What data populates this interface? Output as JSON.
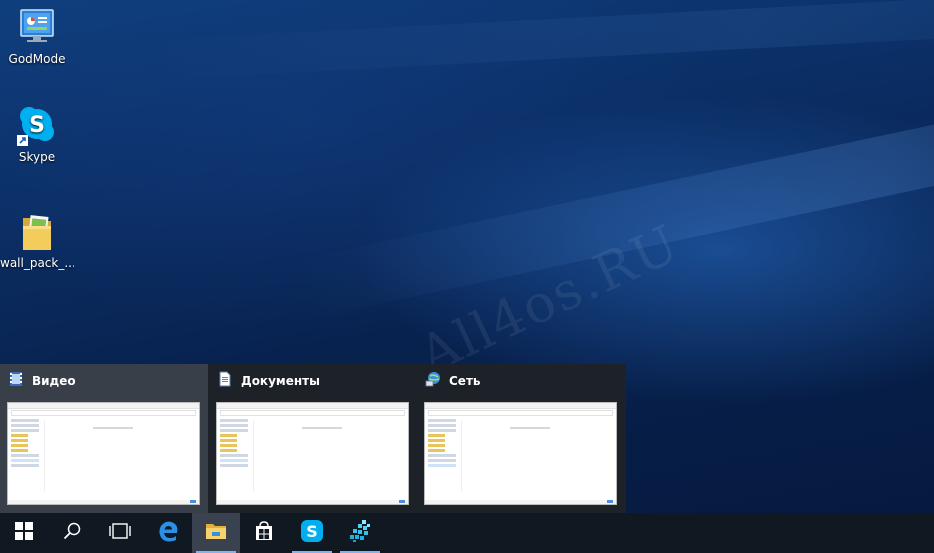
{
  "desktop": {
    "watermark": "All4os.RU",
    "icons": [
      {
        "label": "GodMode",
        "icon": "control-panel-icon"
      },
      {
        "label": "Skype",
        "icon": "skype-icon"
      },
      {
        "label": "wall_pack_...",
        "icon": "folder-icon"
      }
    ]
  },
  "flyout": {
    "windows": [
      {
        "title": "Видео",
        "icon": "videos-folder-icon"
      },
      {
        "title": "Документы",
        "icon": "documents-folder-icon"
      },
      {
        "title": "Сеть",
        "icon": "network-icon"
      }
    ]
  },
  "taskbar": {
    "buttons": [
      {
        "name": "start",
        "icon": "windows-logo-icon"
      },
      {
        "name": "search",
        "icon": "search-icon"
      },
      {
        "name": "task-view",
        "icon": "task-view-icon"
      },
      {
        "name": "edge",
        "icon": "edge-icon"
      },
      {
        "name": "file-explorer",
        "icon": "file-explorer-icon",
        "state": "active"
      },
      {
        "name": "store",
        "icon": "store-icon"
      },
      {
        "name": "skype",
        "icon": "skype-icon",
        "state": "running"
      },
      {
        "name": "app",
        "icon": "app-tiles-icon",
        "state": "running"
      }
    ]
  },
  "colors": {
    "taskbar": "#101822",
    "accent": "#7fb4ee",
    "skype": "#00aff0",
    "folder": "#e8c45a"
  }
}
